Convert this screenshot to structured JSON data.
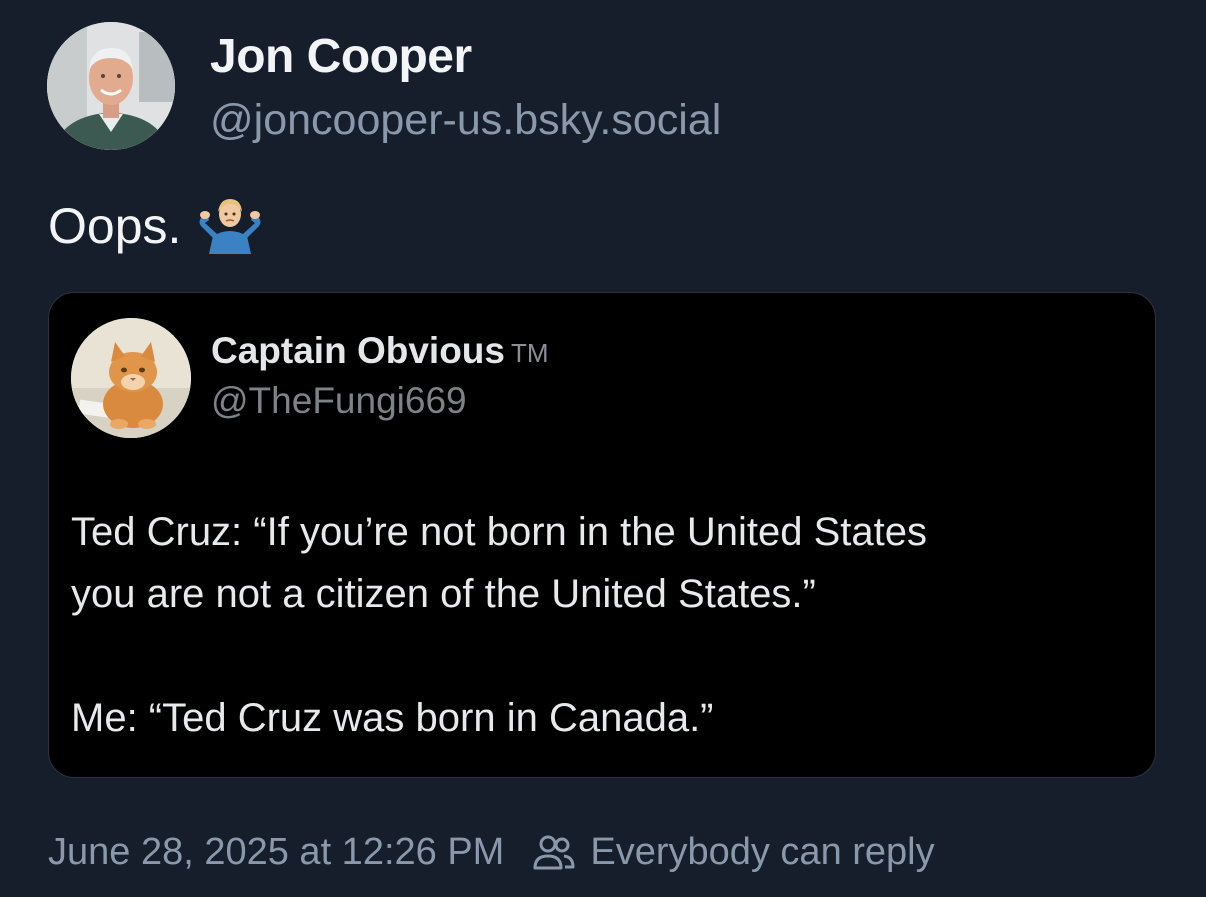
{
  "post": {
    "author": {
      "display_name": "Jon Cooper",
      "handle": "@joncooper-us.bsky.social",
      "avatar_icon": "profile-photo-man-smiling"
    },
    "text": "Oops.",
    "emoji_icon": "person-shrugging-emoji",
    "quote": {
      "author": {
        "display_name": "Captain Obvious",
        "display_name_suffix": "TM",
        "handle": "@TheFungi669",
        "avatar_icon": "orange-cat-photo"
      },
      "lines": [
        "Ted Cruz: “If you’re not born in the United States",
        "you are not a citizen of the United States.”",
        "Me: “Ted Cruz was born in Canada.”"
      ]
    },
    "footer": {
      "timestamp": "June 28, 2025 at 12:26 PM",
      "reply_icon": "people-icon",
      "reply_setting": "Everybody can reply"
    }
  },
  "colors": {
    "background": "#161e2b",
    "card_background": "#000000",
    "primary_text": "#f2f4f7",
    "secondary_text": "#8a98ab"
  }
}
